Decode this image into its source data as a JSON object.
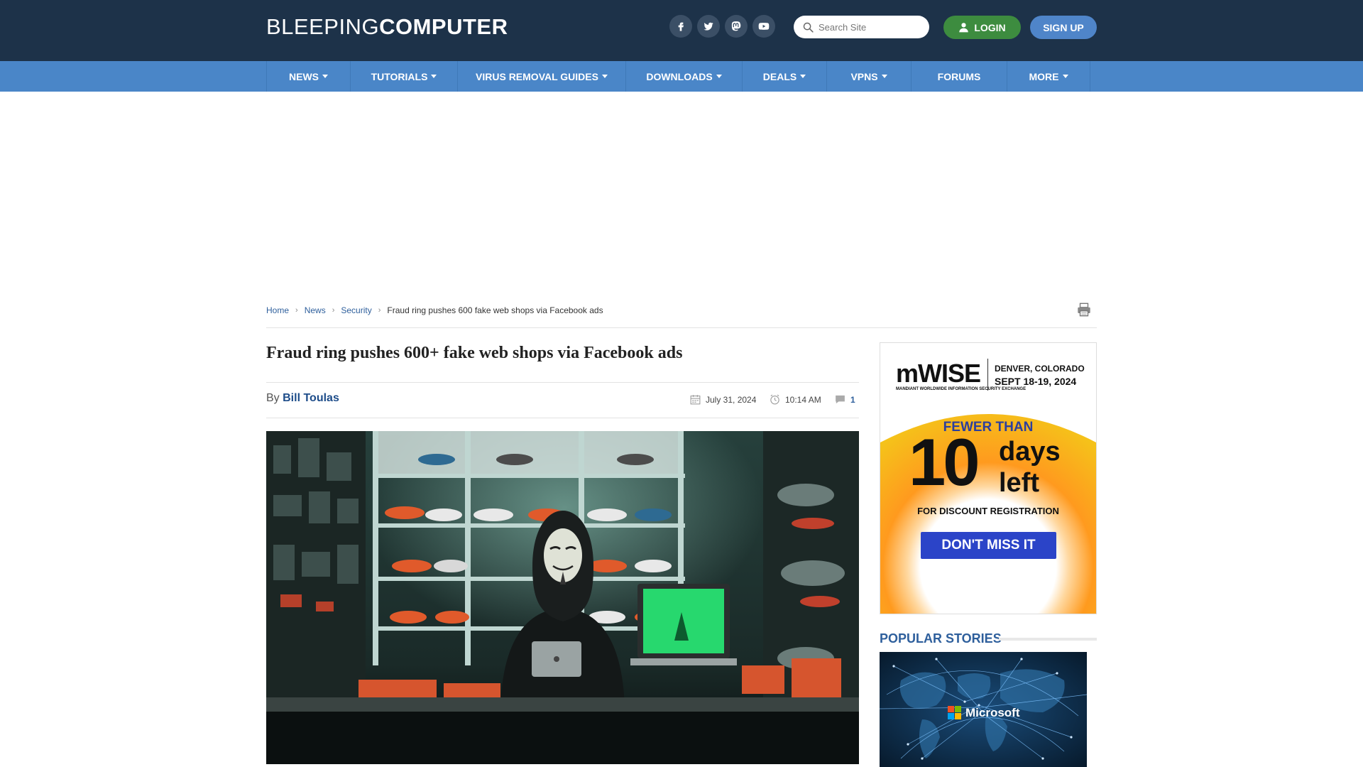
{
  "header": {
    "logo_light": "BLEEPING",
    "logo_bold": "COMPUTER",
    "social": [
      {
        "name": "facebook-icon"
      },
      {
        "name": "twitter-icon"
      },
      {
        "name": "mastodon-icon"
      },
      {
        "name": "youtube-icon"
      }
    ],
    "search_placeholder": "Search Site",
    "login_label": "LOGIN",
    "signup_label": "SIGN UP"
  },
  "nav": {
    "items": [
      {
        "label": "NEWS",
        "dropdown": true
      },
      {
        "label": "TUTORIALS",
        "dropdown": true
      },
      {
        "label": "VIRUS REMOVAL GUIDES",
        "dropdown": true
      },
      {
        "label": "DOWNLOADS",
        "dropdown": true
      },
      {
        "label": "DEALS",
        "dropdown": true
      },
      {
        "label": "VPNS",
        "dropdown": true
      },
      {
        "label": "FORUMS",
        "dropdown": false
      },
      {
        "label": "MORE",
        "dropdown": true
      }
    ]
  },
  "breadcrumb": {
    "home": "Home",
    "news": "News",
    "section": "Security",
    "current": "Fraud ring pushes 600 fake web shops via Facebook ads"
  },
  "article": {
    "title": "Fraud ring pushes 600+ fake web shops via Facebook ads",
    "by": "By",
    "author": "Bill Toulas",
    "date": "July 31, 2024",
    "time": "10:14 AM",
    "comments": "1"
  },
  "sidebar": {
    "ad": {
      "brand": "mWISE",
      "brand_sub": "MANDIANT WORLDWIDE INFORMATION SECURITY EXCHANGE",
      "location": "DENVER, COLORADO",
      "dates": "SEPT 18-19, 2024",
      "fewer_than": "FEWER THAN",
      "number": "10",
      "days": "days",
      "left": "left",
      "for_text": "FOR DISCOUNT REGISTRATION",
      "cta": "DON'T MISS IT"
    },
    "popular_title": "POPULAR STORIES",
    "popular_image_label": "Microsoft"
  },
  "colors": {
    "header_bg": "#1d3249",
    "nav_bg": "#4a86c8",
    "login_green": "#3d8c3f",
    "signup_blue": "#4f85c9",
    "link_blue": "#2e5f9c"
  }
}
